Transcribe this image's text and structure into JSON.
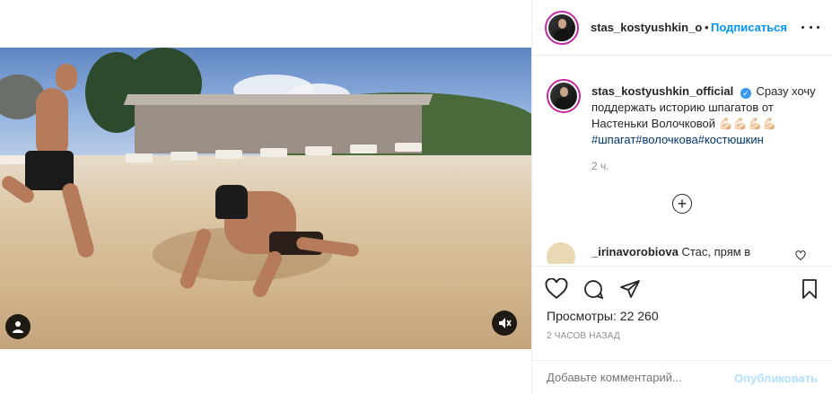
{
  "header": {
    "username": "stas_kostyushkin_o",
    "separator": "•",
    "follow_label": "Подписаться",
    "more_icon": "ellipsis-icon"
  },
  "caption": {
    "username": "stas_kostyushkin_official",
    "verified_icon": "verified-badge-icon",
    "text": "Сразу хочу поддержать историю шпагатов от Настеньки Волочковой 💪🏻💪🏻💪🏻💪🏻",
    "hashtags": "#шпагат#волочкова#костюшкин",
    "time": "2 ч."
  },
  "load_more_icon": "plus-circle-icon",
  "comment": {
    "username": "_irinavorobiova",
    "text": "Стас, прям в",
    "like_icon": "heart-outline-icon"
  },
  "actions": {
    "like_icon": "heart-icon",
    "comment_icon": "comment-icon",
    "share_icon": "paper-plane-icon",
    "save_icon": "bookmark-icon",
    "views_label": "Просмотры:",
    "views_count": "22 260",
    "posted_time": "2 ЧАСОВ НАЗАД"
  },
  "comment_form": {
    "placeholder": "Добавьте комментарий...",
    "publish_label": "Опубликовать"
  },
  "media": {
    "user_tag_icon": "user-icon",
    "mute_icon": "speaker-muted-icon"
  },
  "colors": {
    "accent": "#0095f6",
    "publish_disabled": "#b2dffc",
    "hashtag": "#00376b",
    "muted_text": "#8e8e8e"
  }
}
